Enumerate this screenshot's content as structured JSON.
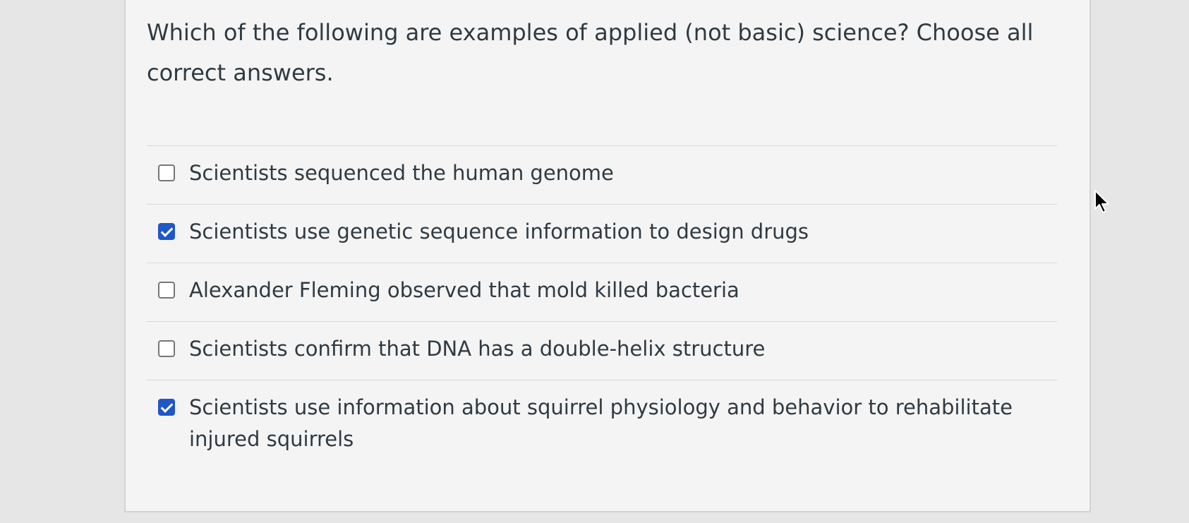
{
  "question": {
    "text": "Which of the following are examples of applied (not basic) science? Choose all correct answers."
  },
  "answers": [
    {
      "label": "Scientists sequenced the human genome",
      "checked": false
    },
    {
      "label": "Scientists use genetic sequence information to design drugs",
      "checked": true
    },
    {
      "label": "Alexander Fleming observed that mold killed bacteria",
      "checked": false
    },
    {
      "label": "Scientists confirm that DNA has a double-helix structure",
      "checked": false
    },
    {
      "label": "Scientists use information about squirrel physiology and behavior to rehabilitate injured squirrels",
      "checked": true
    }
  ],
  "colors": {
    "checkbox_checked": "#1f57c6",
    "text": "#2f3a42"
  },
  "icons": {
    "checked": "checkbox-checked-icon",
    "unchecked": "checkbox-unchecked-icon",
    "cursor": "mouse-pointer-icon"
  }
}
